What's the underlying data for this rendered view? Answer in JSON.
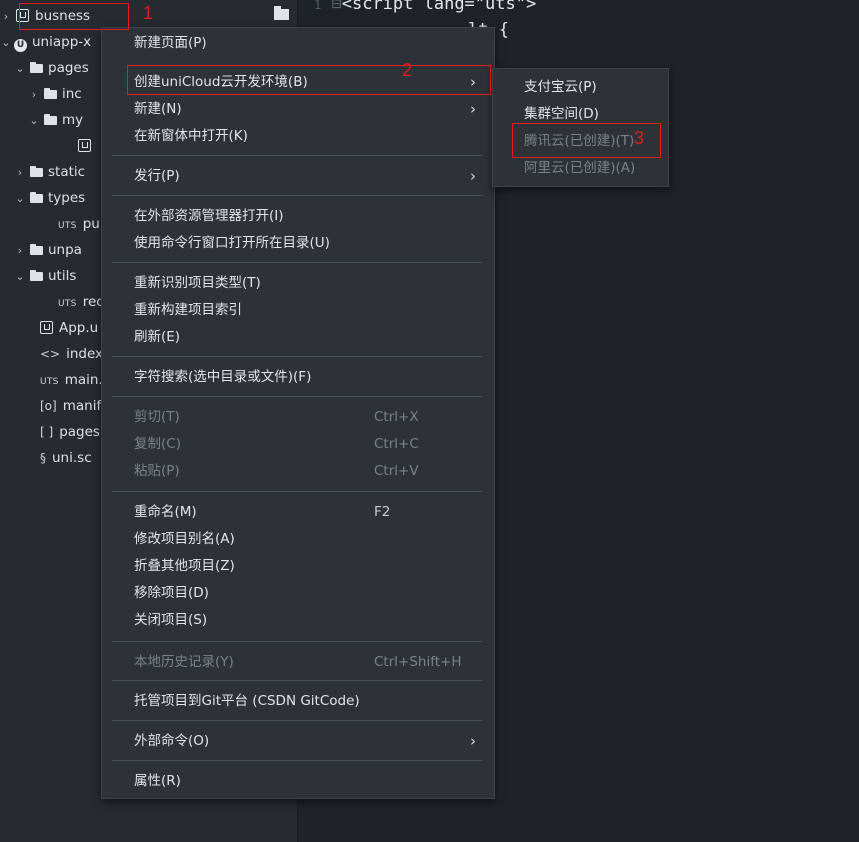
{
  "tree": {
    "items": [
      {
        "label": "busness",
        "icon": "project-icon"
      },
      {
        "label": "uniapp-x",
        "icon": "uniapp-icon"
      },
      {
        "label": "pages",
        "icon": "folder-icon"
      },
      {
        "label": "inc",
        "icon": "folder-icon"
      },
      {
        "label": "my",
        "icon": "folder-icon"
      },
      {
        "label": "",
        "icon": "file-icon"
      },
      {
        "label": "static",
        "icon": "folder-icon"
      },
      {
        "label": "types",
        "icon": "folder-icon"
      },
      {
        "label": "pu",
        "icon": "uts-file-icon",
        "prefix": "UTS"
      },
      {
        "label": "unpa",
        "icon": "folder-icon"
      },
      {
        "label": "utils",
        "icon": "folder-icon"
      },
      {
        "label": "rec",
        "icon": "uts-file-icon",
        "prefix": "UTS"
      },
      {
        "label": "App.u",
        "icon": "file-icon"
      },
      {
        "label": "index",
        "icon": "html-icon",
        "prefix": "<>"
      },
      {
        "label": "main.",
        "icon": "uts-file-icon",
        "prefix": "UTS"
      },
      {
        "label": "manif",
        "icon": "manifest-icon",
        "prefix": "[o]"
      },
      {
        "label": "pages",
        "icon": "json-icon",
        "prefix": "[ ]"
      },
      {
        "label": "uni.sc",
        "icon": "scss-icon",
        "prefix": "§"
      }
    ]
  },
  "editor": {
    "line_number": "1",
    "line1": "<script lang=\"uts\">",
    "line2": "lt {"
  },
  "menu": {
    "items": [
      {
        "label": "新建页面(P)",
        "shortcut": "",
        "arrow": ""
      },
      {
        "label": "创建uniCloud云开发环境(B)",
        "shortcut": "",
        "arrow": "›"
      },
      {
        "label": "新建(N)",
        "shortcut": "",
        "arrow": "›"
      },
      {
        "label": "在新窗体中打开(K)",
        "shortcut": "",
        "arrow": ""
      },
      {
        "label": "发行(P)",
        "shortcut": "",
        "arrow": "›"
      },
      {
        "label": "在外部资源管理器打开(I)",
        "shortcut": "",
        "arrow": ""
      },
      {
        "label": "使用命令行窗口打开所在目录(U)",
        "shortcut": "",
        "arrow": ""
      },
      {
        "label": "重新识别项目类型(T)",
        "shortcut": "",
        "arrow": ""
      },
      {
        "label": "重新构建项目索引",
        "shortcut": "",
        "arrow": ""
      },
      {
        "label": "刷新(E)",
        "shortcut": "",
        "arrow": ""
      },
      {
        "label": "字符搜索(选中目录或文件)(F)",
        "shortcut": "",
        "arrow": ""
      },
      {
        "label": "剪切(T)",
        "shortcut": "Ctrl+X",
        "arrow": ""
      },
      {
        "label": "复制(C)",
        "shortcut": "Ctrl+C",
        "arrow": ""
      },
      {
        "label": "粘贴(P)",
        "shortcut": "Ctrl+V",
        "arrow": ""
      },
      {
        "label": "重命名(M)",
        "shortcut": "F2",
        "arrow": ""
      },
      {
        "label": "修改项目别名(A)",
        "shortcut": "",
        "arrow": ""
      },
      {
        "label": "折叠其他项目(Z)",
        "shortcut": "",
        "arrow": ""
      },
      {
        "label": "移除项目(D)",
        "shortcut": "",
        "arrow": ""
      },
      {
        "label": "关闭项目(S)",
        "shortcut": "",
        "arrow": ""
      },
      {
        "label": "本地历史记录(Y)",
        "shortcut": "Ctrl+Shift+H",
        "arrow": ""
      },
      {
        "label": "托管项目到Git平台 (CSDN GitCode)",
        "shortcut": "",
        "arrow": ""
      },
      {
        "label": "外部命令(O)",
        "shortcut": "",
        "arrow": "›"
      },
      {
        "label": "属性(R)",
        "shortcut": "",
        "arrow": ""
      }
    ]
  },
  "submenu": {
    "items": [
      {
        "label": "支付宝云(P)"
      },
      {
        "label": "集群空间(D)"
      },
      {
        "label": "腾讯云(已创建)(T)"
      },
      {
        "label": "阿里云(已创建)(A)"
      }
    ]
  },
  "annotations": {
    "n1": "1",
    "n2": "2",
    "n3": "3"
  },
  "colors": {
    "annotation": "#e01c1c",
    "menu_bg": "#2d3238",
    "panel_bg": "#262b32"
  }
}
